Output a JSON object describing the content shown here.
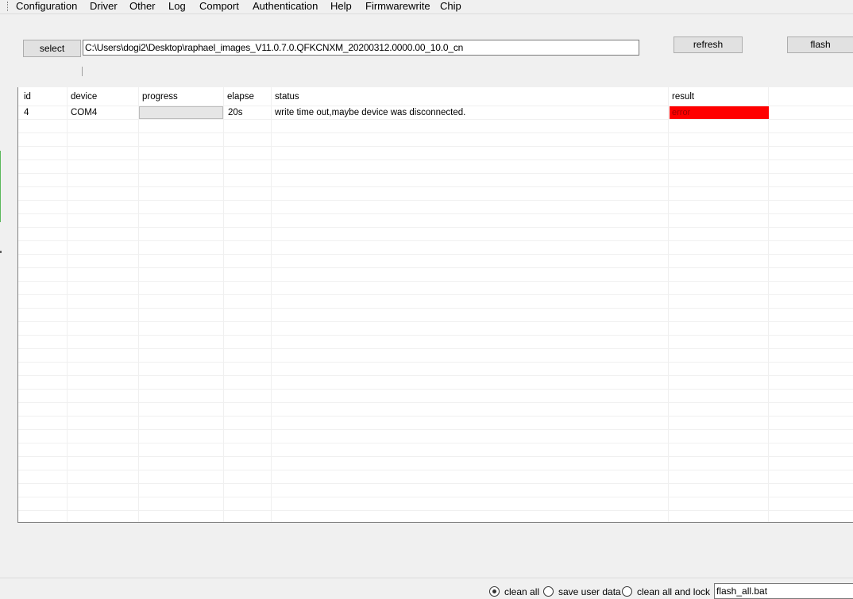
{
  "menu": [
    "Configuration",
    "Driver",
    "Other",
    "Log",
    "Comport",
    "Authentication",
    "Help",
    "Firmwarewrite",
    "Chip"
  ],
  "toolbar": {
    "select_label": "select",
    "path_value": "C:\\Users\\dogi2\\Desktop\\raphael_images_V11.0.7.0.QFKCNXM_20200312.0000.00_10.0_cn",
    "refresh_label": "refresh",
    "flash_label": "flash"
  },
  "table": {
    "headers": {
      "id": "id",
      "device": "device",
      "progress": "progress",
      "elapse": "elapse",
      "status": "status",
      "result": "result"
    },
    "rows": [
      {
        "id": "4",
        "device": "COM4",
        "progress": 0,
        "elapse": "20s",
        "status": "write time out,maybe device was disconnected.",
        "result": "error"
      }
    ]
  },
  "options": {
    "clean_all": "clean all",
    "save_user_data": "save user data",
    "clean_all_and_lock": "clean all and lock",
    "selected": "clean all",
    "script_value": "flash_all.bat"
  },
  "colors": {
    "result_error_bg": "#ff0000",
    "progress_fill": "#06b025"
  }
}
